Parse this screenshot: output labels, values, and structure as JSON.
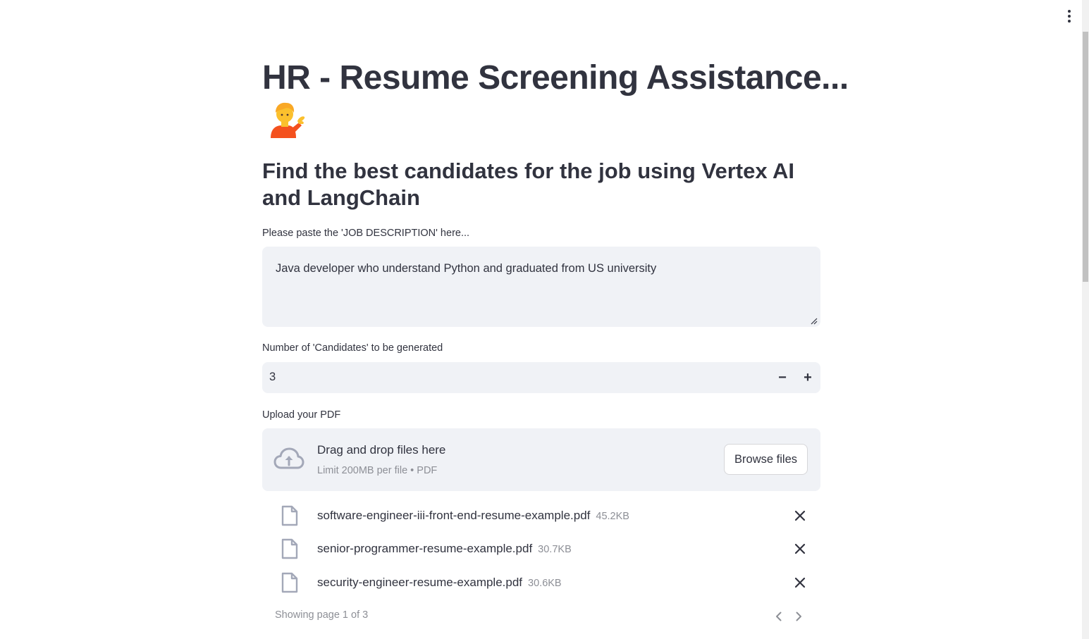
{
  "app": {
    "title": "HR - Resume Screening Assistance...",
    "title_emoji": "person-tipping-hand-emoji",
    "subtitle": "Find the best candidates for the job using Vertex AI and LangChain"
  },
  "job_description": {
    "label": "Please paste the 'JOB DESCRIPTION' here...",
    "value": "Java developer who understand Python and graduated from US university"
  },
  "candidates": {
    "label": "Number of 'Candidates' to be generated",
    "value": "3",
    "minus_label": "−",
    "plus_label": "+"
  },
  "upload": {
    "label": "Upload your PDF",
    "drop_title": "Drag and drop files here",
    "drop_limit": "Limit 200MB per file • PDF",
    "browse_label": "Browse files",
    "files": [
      {
        "name": "software-engineer-iii-front-end-resume-example.pdf",
        "size": "45.2KB"
      },
      {
        "name": "senior-programmer-resume-example.pdf",
        "size": "30.7KB"
      },
      {
        "name": "security-engineer-resume-example.pdf",
        "size": "30.6KB"
      }
    ],
    "pagination": "Showing page 1 of 3"
  },
  "icons": {
    "menu": "kebab-menu-icon",
    "upload": "cloud-upload-icon",
    "file": "file-icon",
    "remove": "close-icon",
    "prev": "chevron-left-icon",
    "next": "chevron-right-icon"
  },
  "colors": {
    "text": "#31333f",
    "muted": "#8d8f96",
    "input_bg": "#f0f2f6",
    "icon": "#a3a8b8"
  }
}
